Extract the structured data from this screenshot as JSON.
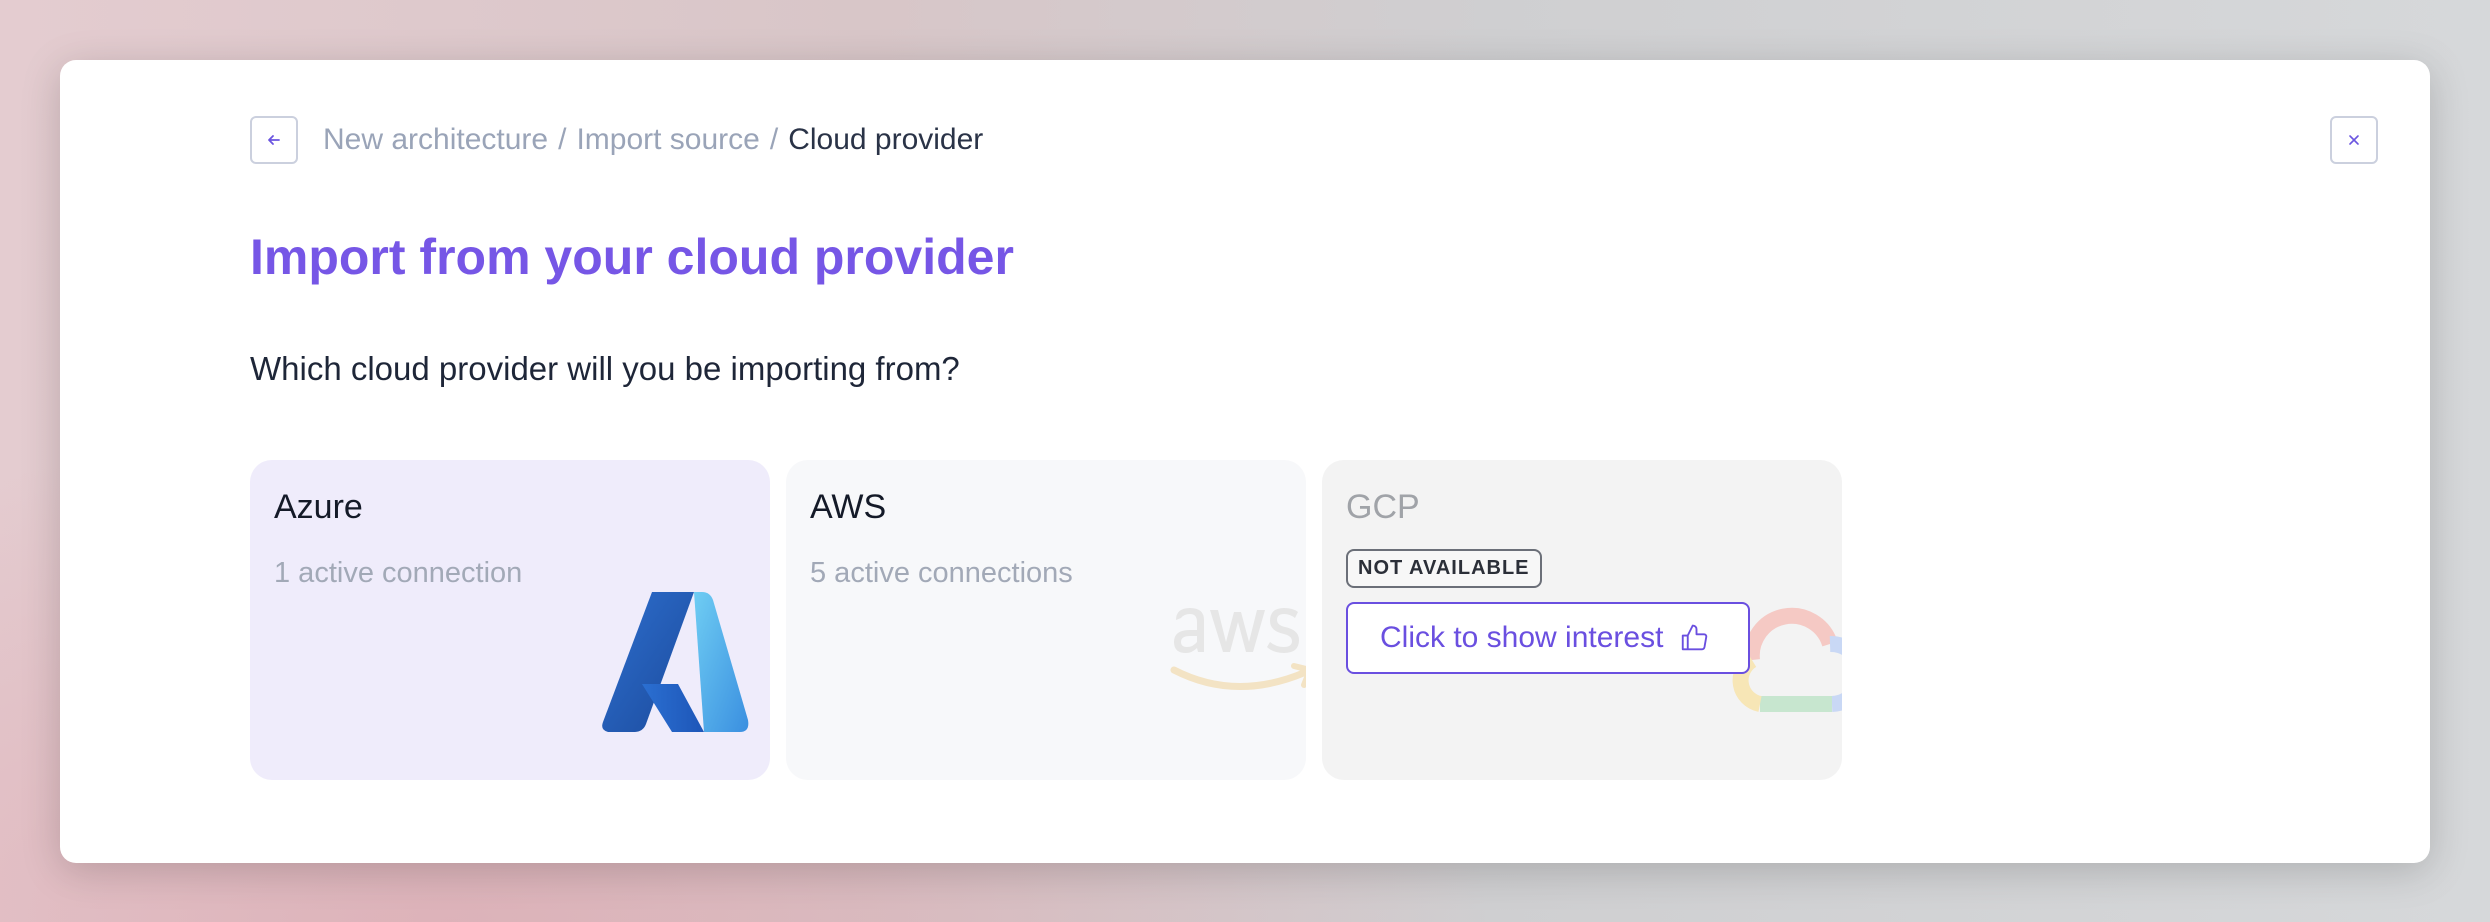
{
  "header": {
    "back_icon": "arrow-left-icon",
    "close_icon": "close-icon",
    "breadcrumb": [
      "New architecture",
      "Import source",
      "Cloud provider"
    ],
    "separator": "/"
  },
  "title": "Import from your cloud provider",
  "subtitle": "Which cloud provider will you be importing from?",
  "providers": [
    {
      "name": "Azure",
      "status": "1 active connection",
      "logo": "azure-logo"
    },
    {
      "name": "AWS",
      "status": "5 active connections",
      "logo": "aws-logo"
    },
    {
      "name": "GCP",
      "badge": "NOT AVAILABLE",
      "button_label": "Click to show interest",
      "button_icon": "thumbs-up-icon",
      "logo": "gcp-logo"
    }
  ],
  "colors": {
    "accent": "#7656e6",
    "azure_card_bg": "#efecfb"
  }
}
